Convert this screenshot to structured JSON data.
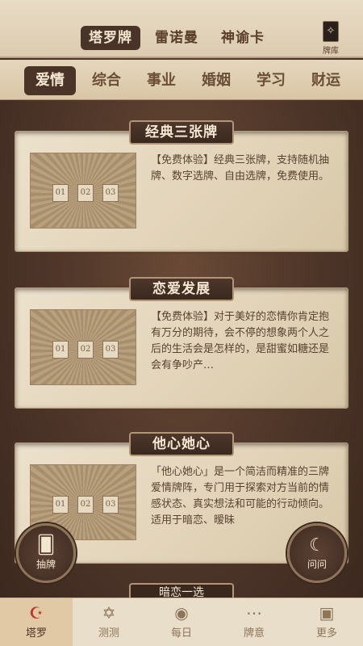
{
  "top_tabs": [
    "塔罗牌",
    "雷诺曼",
    "神谕卡"
  ],
  "deck": {
    "icon": "tarot-card-icon",
    "label": "牌库"
  },
  "categories": [
    "爱情",
    "综合",
    "事业",
    "婚姻",
    "学习",
    "财运"
  ],
  "cards": [
    {
      "title": "经典三张牌",
      "slots": [
        "01",
        "02",
        "03"
      ],
      "desc": "【免费体验】经典三张牌，支持随机抽牌、数字选牌、自由选牌，免费使用。"
    },
    {
      "title": "恋爱发展",
      "slots": [
        "01",
        "02",
        "03"
      ],
      "desc": "【免费体验】对于美好的恋情你肯定抱有万分的期待，会不停的想象两个人之后的生活会是怎样的，是甜蜜如糖还是会有争吵产…"
    },
    {
      "title": "他心她心",
      "slots": [
        "01",
        "02",
        "03"
      ],
      "desc": "「他心她心」是一个简洁而精准的三牌爱情牌阵，专门用于探索对方当前的情感状态、真实想法和可能的行动倾向。适用于暗恋、暧昧"
    }
  ],
  "peek_card_title": "暗恋一选",
  "float_left": {
    "icon": "draw-card-icon",
    "label": "抽牌"
  },
  "float_right": {
    "icon": "ask-icon",
    "label": "问问"
  },
  "bottom_nav": [
    {
      "label": "塔罗",
      "icon": "moon-star-icon"
    },
    {
      "label": "测测",
      "icon": "hexagram-icon"
    },
    {
      "label": "每日",
      "icon": "sun-coin-icon"
    },
    {
      "label": "牌意",
      "icon": "dots-card-icon"
    },
    {
      "label": "更多",
      "icon": "more-card-icon"
    }
  ]
}
